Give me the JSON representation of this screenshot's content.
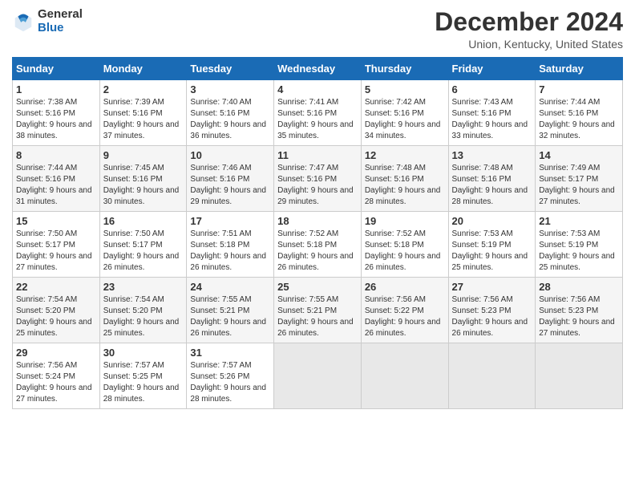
{
  "logo": {
    "general": "General",
    "blue": "Blue"
  },
  "title": "December 2024",
  "location": "Union, Kentucky, United States",
  "days_of_week": [
    "Sunday",
    "Monday",
    "Tuesday",
    "Wednesday",
    "Thursday",
    "Friday",
    "Saturday"
  ],
  "weeks": [
    [
      {
        "day": "1",
        "sunrise": "7:38 AM",
        "sunset": "5:16 PM",
        "daylight": "9 hours and 38 minutes."
      },
      {
        "day": "2",
        "sunrise": "7:39 AM",
        "sunset": "5:16 PM",
        "daylight": "9 hours and 37 minutes."
      },
      {
        "day": "3",
        "sunrise": "7:40 AM",
        "sunset": "5:16 PM",
        "daylight": "9 hours and 36 minutes."
      },
      {
        "day": "4",
        "sunrise": "7:41 AM",
        "sunset": "5:16 PM",
        "daylight": "9 hours and 35 minutes."
      },
      {
        "day": "5",
        "sunrise": "7:42 AM",
        "sunset": "5:16 PM",
        "daylight": "9 hours and 34 minutes."
      },
      {
        "day": "6",
        "sunrise": "7:43 AM",
        "sunset": "5:16 PM",
        "daylight": "9 hours and 33 minutes."
      },
      {
        "day": "7",
        "sunrise": "7:44 AM",
        "sunset": "5:16 PM",
        "daylight": "9 hours and 32 minutes."
      }
    ],
    [
      {
        "day": "8",
        "sunrise": "7:44 AM",
        "sunset": "5:16 PM",
        "daylight": "9 hours and 31 minutes."
      },
      {
        "day": "9",
        "sunrise": "7:45 AM",
        "sunset": "5:16 PM",
        "daylight": "9 hours and 30 minutes."
      },
      {
        "day": "10",
        "sunrise": "7:46 AM",
        "sunset": "5:16 PM",
        "daylight": "9 hours and 29 minutes."
      },
      {
        "day": "11",
        "sunrise": "7:47 AM",
        "sunset": "5:16 PM",
        "daylight": "9 hours and 29 minutes."
      },
      {
        "day": "12",
        "sunrise": "7:48 AM",
        "sunset": "5:16 PM",
        "daylight": "9 hours and 28 minutes."
      },
      {
        "day": "13",
        "sunrise": "7:48 AM",
        "sunset": "5:16 PM",
        "daylight": "9 hours and 28 minutes."
      },
      {
        "day": "14",
        "sunrise": "7:49 AM",
        "sunset": "5:17 PM",
        "daylight": "9 hours and 27 minutes."
      }
    ],
    [
      {
        "day": "15",
        "sunrise": "7:50 AM",
        "sunset": "5:17 PM",
        "daylight": "9 hours and 27 minutes."
      },
      {
        "day": "16",
        "sunrise": "7:50 AM",
        "sunset": "5:17 PM",
        "daylight": "9 hours and 26 minutes."
      },
      {
        "day": "17",
        "sunrise": "7:51 AM",
        "sunset": "5:18 PM",
        "daylight": "9 hours and 26 minutes."
      },
      {
        "day": "18",
        "sunrise": "7:52 AM",
        "sunset": "5:18 PM",
        "daylight": "9 hours and 26 minutes."
      },
      {
        "day": "19",
        "sunrise": "7:52 AM",
        "sunset": "5:18 PM",
        "daylight": "9 hours and 26 minutes."
      },
      {
        "day": "20",
        "sunrise": "7:53 AM",
        "sunset": "5:19 PM",
        "daylight": "9 hours and 25 minutes."
      },
      {
        "day": "21",
        "sunrise": "7:53 AM",
        "sunset": "5:19 PM",
        "daylight": "9 hours and 25 minutes."
      }
    ],
    [
      {
        "day": "22",
        "sunrise": "7:54 AM",
        "sunset": "5:20 PM",
        "daylight": "9 hours and 25 minutes."
      },
      {
        "day": "23",
        "sunrise": "7:54 AM",
        "sunset": "5:20 PM",
        "daylight": "9 hours and 25 minutes."
      },
      {
        "day": "24",
        "sunrise": "7:55 AM",
        "sunset": "5:21 PM",
        "daylight": "9 hours and 26 minutes."
      },
      {
        "day": "25",
        "sunrise": "7:55 AM",
        "sunset": "5:21 PM",
        "daylight": "9 hours and 26 minutes."
      },
      {
        "day": "26",
        "sunrise": "7:56 AM",
        "sunset": "5:22 PM",
        "daylight": "9 hours and 26 minutes."
      },
      {
        "day": "27",
        "sunrise": "7:56 AM",
        "sunset": "5:23 PM",
        "daylight": "9 hours and 26 minutes."
      },
      {
        "day": "28",
        "sunrise": "7:56 AM",
        "sunset": "5:23 PM",
        "daylight": "9 hours and 27 minutes."
      }
    ],
    [
      {
        "day": "29",
        "sunrise": "7:56 AM",
        "sunset": "5:24 PM",
        "daylight": "9 hours and 27 minutes."
      },
      {
        "day": "30",
        "sunrise": "7:57 AM",
        "sunset": "5:25 PM",
        "daylight": "9 hours and 28 minutes."
      },
      {
        "day": "31",
        "sunrise": "7:57 AM",
        "sunset": "5:26 PM",
        "daylight": "9 hours and 28 minutes."
      },
      null,
      null,
      null,
      null
    ]
  ]
}
